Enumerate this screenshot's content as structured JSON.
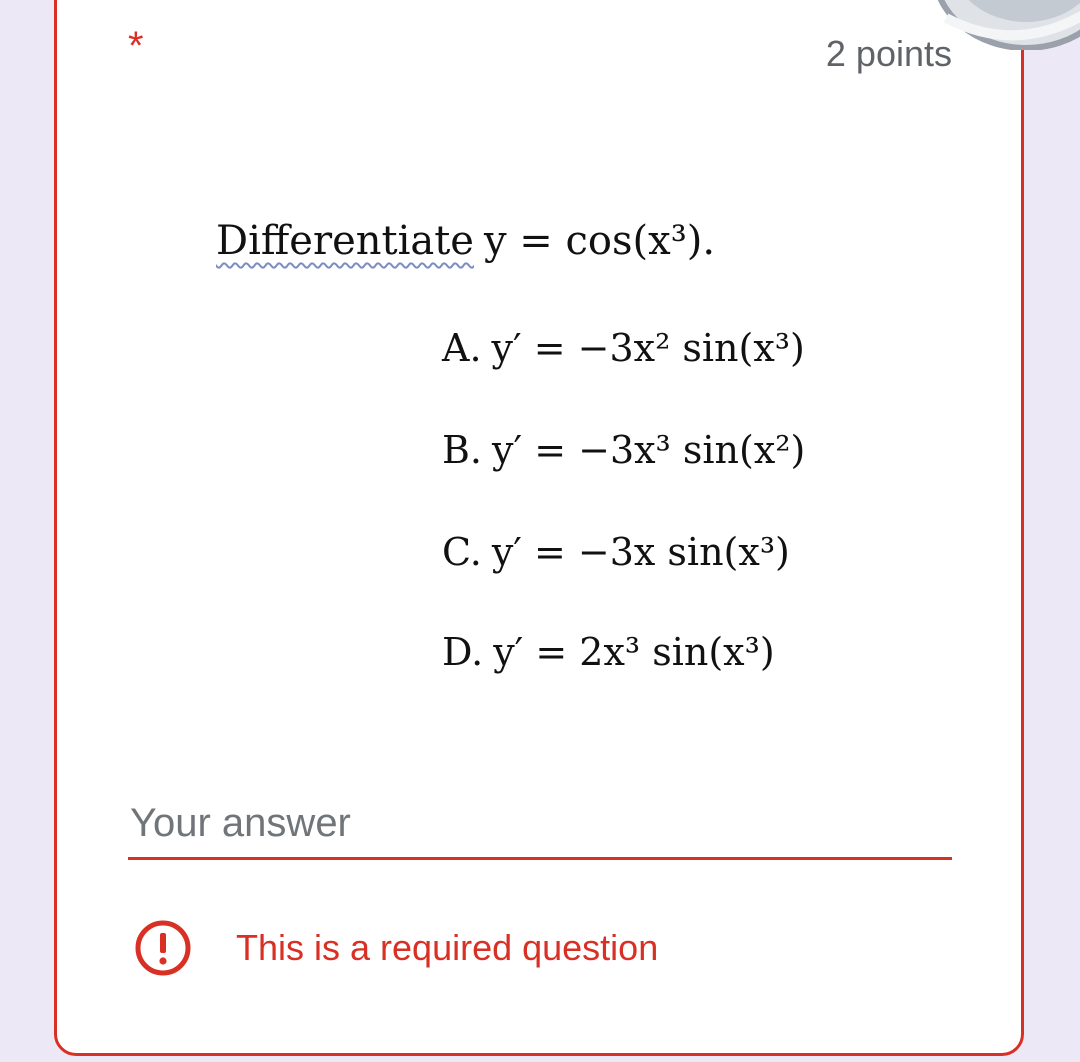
{
  "question": {
    "required_marker": "*",
    "points": "2 points",
    "prompt_word": "Differentiate",
    "prompt_expr": "y = cos(x³).",
    "options": [
      {
        "label": "A.",
        "expr": "y′ = −3x² sin(x³)"
      },
      {
        "label": "B.",
        "expr": "y′ = −3x³ sin(x²)"
      },
      {
        "label": "C.",
        "expr": "y′ = −3x  sin(x³)"
      },
      {
        "label": "D.",
        "expr": "y′ = 2x³ sin(x³)"
      }
    ]
  },
  "answer": {
    "placeholder": "Your answer",
    "value": ""
  },
  "validation": {
    "message": "This is a required question",
    "icon": "error-icon"
  },
  "colors": {
    "error": "#d93025",
    "background": "#ece8f6",
    "card": "#ffffff",
    "muted_text": "#5f6368"
  }
}
